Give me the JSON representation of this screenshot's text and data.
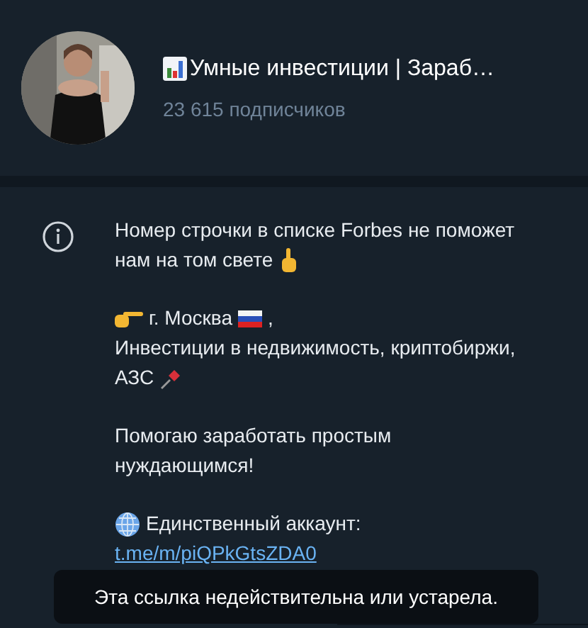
{
  "channel": {
    "title": "Умные инвестиции | Зараб…",
    "subscribers": "23 615 подписчиков"
  },
  "description": [
    [
      [
        "Номер строчки в списке Forbes не поможет"
      ],
      [
        "нам на том свете"
      ]
    ],
    [
      [
        "г. Москва",
        ","
      ],
      [
        "Инвестиции в недвижимость, криптобиржи,"
      ],
      [
        "АЗС"
      ]
    ],
    [
      [
        "Помогаю заработать простым"
      ],
      [
        "нуждающимся!"
      ]
    ],
    [
      [
        "Единственный аккаунт:"
      ]
    ]
  ],
  "link": "t.me/m/piQPkGtsZDA0",
  "toast": "Эта ссылка недействительна или устарела."
}
